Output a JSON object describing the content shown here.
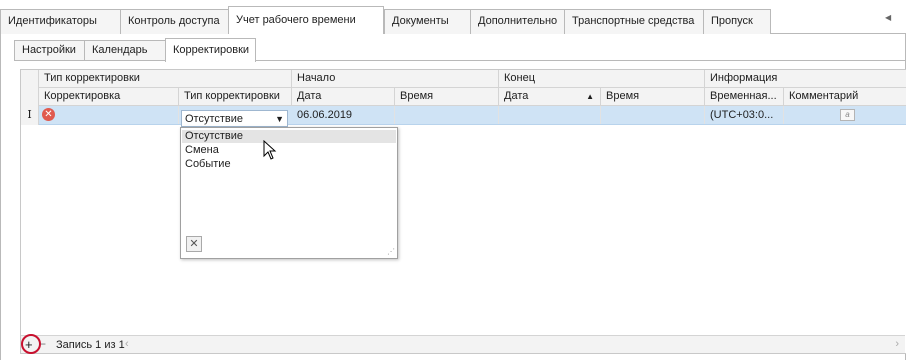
{
  "top_tabs": [
    {
      "label": "Идентификаторы",
      "active": false
    },
    {
      "label": "Контроль доступа",
      "active": false
    },
    {
      "label": "Учет рабочего времени",
      "active": true
    },
    {
      "label": "Документы",
      "active": false
    },
    {
      "label": "Дополнительно",
      "active": false
    },
    {
      "label": "Транспортные средства",
      "active": false
    },
    {
      "label": "Пропуск",
      "active": false
    }
  ],
  "sub_tabs": [
    {
      "label": "Настройки",
      "active": false
    },
    {
      "label": "Календарь",
      "active": false
    },
    {
      "label": "Корректировки",
      "active": true
    }
  ],
  "grid": {
    "band_headers": [
      "Тип корректировки",
      "Начало",
      "Конец",
      "Информация"
    ],
    "columns": [
      "Корректировка",
      "Тип корректировки",
      "Дата",
      "Время",
      "Дата",
      "Время",
      "Временная...",
      "Комментарий"
    ],
    "sort_column": "Дата",
    "row": {
      "indicator": "I",
      "type": "Отсутствие",
      "start_date": "06.06.2019",
      "start_time": "",
      "end_date": "",
      "end_time": "",
      "timezone": "(UTC+03:0...",
      "comment": "a"
    }
  },
  "dropdown": {
    "options": [
      "Отсутствие",
      "Смена",
      "Событие"
    ],
    "hovered": "Отсутствие"
  },
  "navigator": {
    "record_text": "Запись 1 из 1",
    "add": "+",
    "remove": "−"
  },
  "colors": {
    "selected_row": "#cfe3f5",
    "error_icon": "#d9534f",
    "highlight_circle": "#c8102e"
  }
}
